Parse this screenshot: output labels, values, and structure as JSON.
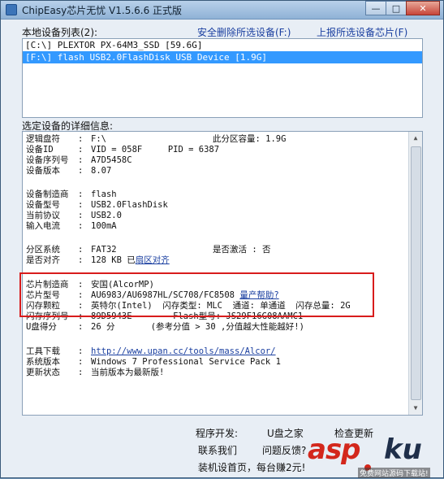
{
  "window": {
    "title": "ChipEasy芯片无忧 V1.5.6.6 正式版",
    "controls": {
      "minimize": "—",
      "maximize": "□",
      "close": "✕"
    }
  },
  "top": {
    "device_list_label": "本地设备列表(2):",
    "delete_link": "安全删除所选设备(F:)",
    "report_link": "上报所选设备芯片(F)"
  },
  "devices": [
    {
      "text": "[C:\\] PLEXTOR PX-64M3_SSD [59.6G]",
      "selected": false
    },
    {
      "text": "[F:\\] flash USB2.0FlashDisk USB Device [1.9G]",
      "selected": true
    }
  ],
  "details_label": "选定设备的详细信息:",
  "details": {
    "drive_letter_k": "逻辑盘符",
    "drive_letter_v": "F:\\",
    "partition_k": "此分区容量:",
    "partition_v": "1.9G",
    "device_id_k": "设备ID",
    "device_id_v": "VID = 058F     PID = 6387",
    "serial_k": "设备序列号",
    "serial_v": "A7D5458C",
    "version_k": "设备版本",
    "version_v": "8.07",
    "maker_k": "设备制造商",
    "maker_v": "flash",
    "model_k": "设备型号",
    "model_v": "USB2.0FlashDisk",
    "protocol_k": "当前协议",
    "protocol_v": "USB2.0",
    "current_k": "输入电流",
    "current_v": "100mA",
    "fs_k": "分区系统",
    "fs_v": "FAT32",
    "active_k": "是否激活",
    "active_v": "否",
    "align_k": "是否对齐",
    "align_v": "128 KB 已",
    "align_link": "扇区对齐",
    "chip_maker_k": "芯片制造商",
    "chip_maker_v": "安国(AlcorMP)",
    "chip_model_k": "芯片型号",
    "chip_model_v": "AU6983/AU6987HL/SC708/FC8508",
    "chip_help": "量产帮助?",
    "flash_k": "闪存颗粒",
    "flash_v": "英特尔(Intel)  闪存类型: MLC  通道: 单通道  闪存总量: 2G",
    "flash_serial_k": "闪存序列号",
    "flash_serial_v": "89D5943E        Flash型号: JS29F16G08AAMC1",
    "score_k": "U盘得分",
    "score_v": "26 分       (参考分值 > 30 ,分值越大性能越好!)",
    "tool_k": "工具下载",
    "tool_v": "http://www.upan.cc/tools/mass/Alcor/",
    "os_k": "系统版本",
    "os_v": "Windows 7 Professional Service Pack 1",
    "update_k": "更新状态",
    "update_v": "当前版本为最新版!",
    "colon": ":"
  },
  "footer": {
    "dev_label": "程序开发:",
    "dev_value": "U盘之家",
    "check_update": "检查更新",
    "contact": "联系我们",
    "feedback": "问题反馈?",
    "install_slogan": "装机设首页，每台赚2元!"
  },
  "watermark": {
    "asp": "asp",
    "ku": "ku",
    "sub": "免费网站源码下载站!"
  },
  "colors": {
    "selection": "#3399ff",
    "highlight_box": "#d81c1c",
    "link": "#1a3fa0"
  }
}
